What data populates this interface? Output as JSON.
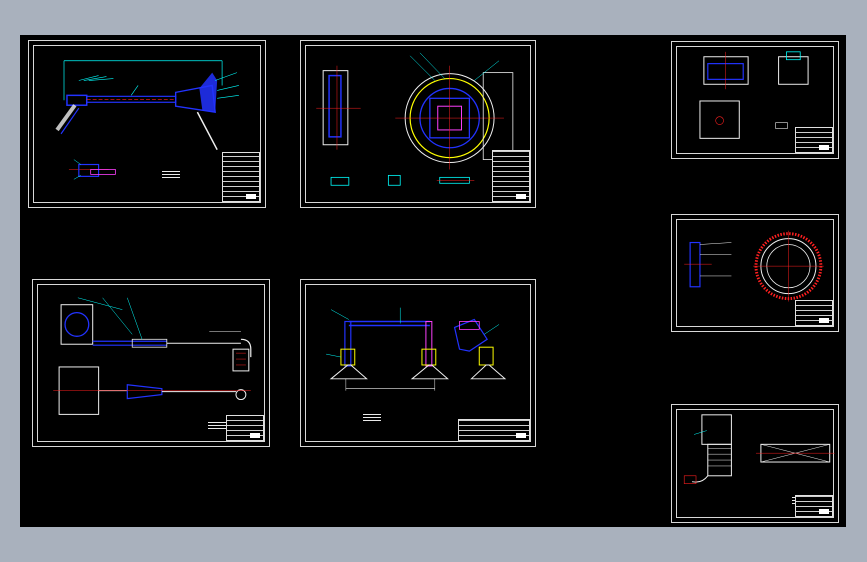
{
  "app": {
    "background_color": "#a9b1bd",
    "canvas_color": "#000000",
    "frame_color": "#d8d8d8"
  },
  "drawing": {
    "sheet_count": 7,
    "palette": {
      "blue": "#2233ff",
      "cyan": "#00ffff",
      "red": "#ff2020",
      "yellow": "#ffff00",
      "magenta": "#ff40ff",
      "white": "#f0f0f0",
      "green": "#00ff40"
    }
  }
}
